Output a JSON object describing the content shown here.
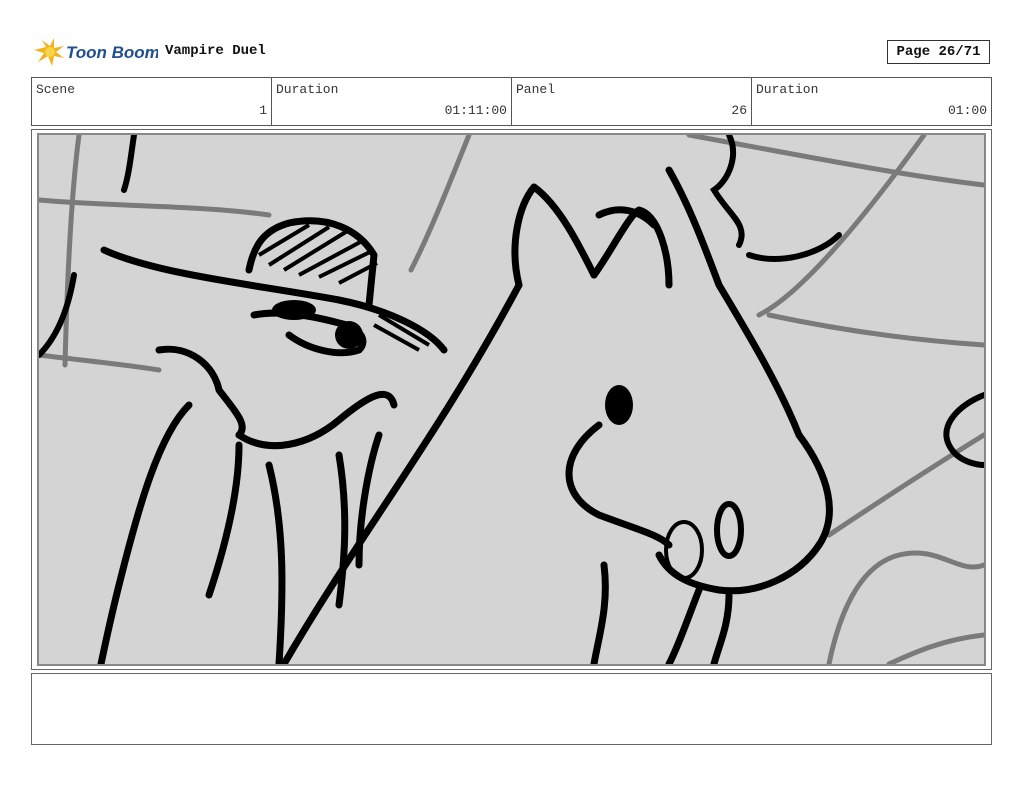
{
  "header": {
    "logo_text": "Toon Boom",
    "project_title": "Vampire Duel",
    "page_label": "Page 26/71"
  },
  "info": {
    "scene_label": "Scene",
    "scene_value": "1",
    "duration_label": "Duration",
    "duration_value": "01:11:00",
    "panel_label": "Panel",
    "panel_value": "26",
    "panel_duration_label": "Duration",
    "panel_duration_value": "01:00"
  },
  "panel": {
    "image": "storyboard-sketch-cowboy-and-horse"
  },
  "notes": {
    "text": ""
  }
}
